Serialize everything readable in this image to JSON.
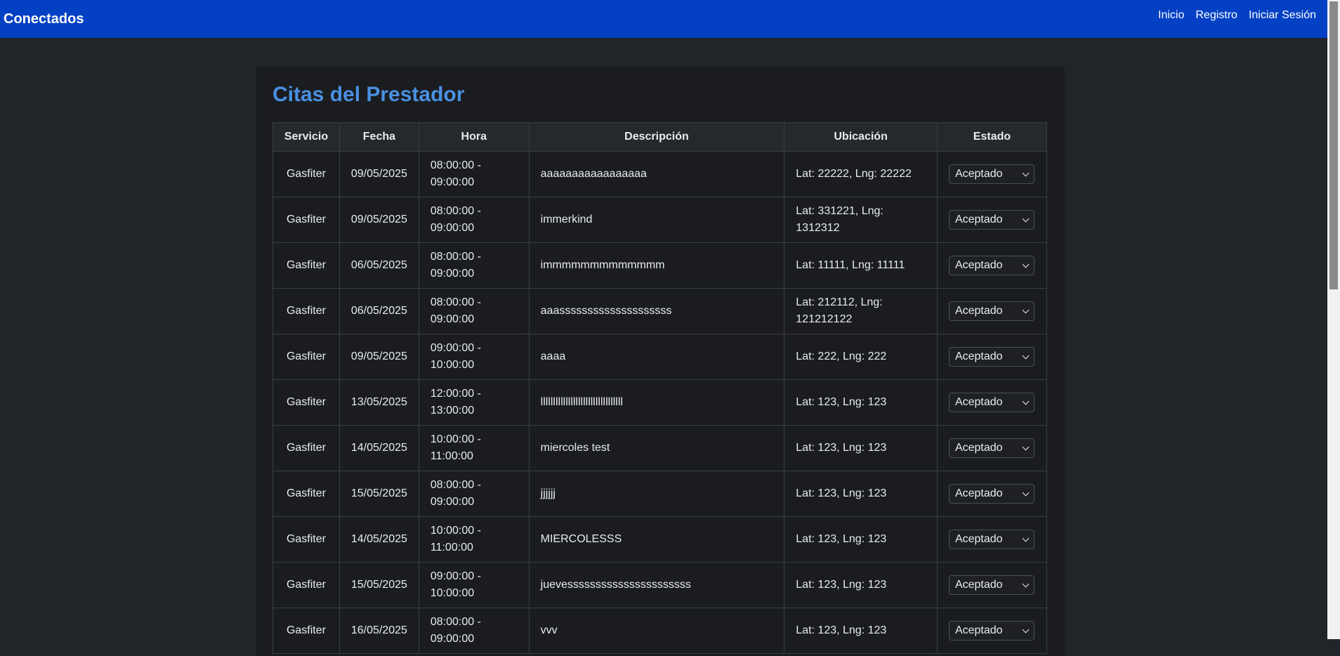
{
  "navbar": {
    "brand": "Conectados",
    "links": [
      "Inicio",
      "Registro",
      "Iniciar Sesión"
    ]
  },
  "page": {
    "title": "Citas del Prestador"
  },
  "table": {
    "headers": [
      "Servicio",
      "Fecha",
      "Hora",
      "Descripción",
      "Ubicación",
      "Estado"
    ],
    "rows": [
      {
        "servicio": "Gasfiter",
        "fecha": "09/05/2025",
        "hora": "08:00:00 - 09:00:00",
        "descripcion": "aaaaaaaaaaaaaaaaa",
        "ubicacion": "Lat: 22222, Lng: 22222",
        "estado": "Aceptado"
      },
      {
        "servicio": "Gasfiter",
        "fecha": "09/05/2025",
        "hora": "08:00:00 - 09:00:00",
        "descripcion": "immerkind",
        "ubicacion": "Lat: 331221, Lng: 1312312",
        "estado": "Aceptado"
      },
      {
        "servicio": "Gasfiter",
        "fecha": "06/05/2025",
        "hora": "08:00:00 - 09:00:00",
        "descripcion": "immmmmmmmmmmmm",
        "ubicacion": "Lat: 11111, Lng: 11111",
        "estado": "Aceptado"
      },
      {
        "servicio": "Gasfiter",
        "fecha": "06/05/2025",
        "hora": "08:00:00 - 09:00:00",
        "descripcion": "aaassssssssssssssssssss",
        "ubicacion": "Lat: 212112, Lng: 121212122",
        "estado": "Aceptado"
      },
      {
        "servicio": "Gasfiter",
        "fecha": "09/05/2025",
        "hora": "09:00:00 - 10:00:00",
        "descripcion": "aaaa",
        "ubicacion": "Lat: 222, Lng: 222",
        "estado": "Aceptado"
      },
      {
        "servicio": "Gasfiter",
        "fecha": "13/05/2025",
        "hora": "12:00:00 - 13:00:00",
        "descripcion": "lllllllllllllllllllllllllllllllll",
        "ubicacion": "Lat: 123, Lng: 123",
        "estado": "Aceptado"
      },
      {
        "servicio": "Gasfiter",
        "fecha": "14/05/2025",
        "hora": "10:00:00 - 11:00:00",
        "descripcion": "miercoles test",
        "ubicacion": "Lat: 123, Lng: 123",
        "estado": "Aceptado"
      },
      {
        "servicio": "Gasfiter",
        "fecha": "15/05/2025",
        "hora": "08:00:00 - 09:00:00",
        "descripcion": "jjjjjj",
        "ubicacion": "Lat: 123, Lng: 123",
        "estado": "Aceptado"
      },
      {
        "servicio": "Gasfiter",
        "fecha": "14/05/2025",
        "hora": "10:00:00 - 11:00:00",
        "descripcion": "MIERCOLESSS",
        "ubicacion": "Lat: 123, Lng: 123",
        "estado": "Aceptado"
      },
      {
        "servicio": "Gasfiter",
        "fecha": "15/05/2025",
        "hora": "09:00:00 - 10:00:00",
        "descripcion": "juevessssssssssssssssssssss",
        "ubicacion": "Lat: 123, Lng: 123",
        "estado": "Aceptado"
      },
      {
        "servicio": "Gasfiter",
        "fecha": "16/05/2025",
        "hora": "08:00:00 - 09:00:00",
        "descripcion": "vvv",
        "ubicacion": "Lat: 123, Lng: 123",
        "estado": "Aceptado"
      }
    ]
  },
  "icons": {
    "select_arrow": "chevron-down-icon"
  },
  "colors": {
    "navbar": "#0440c4",
    "title": "#4a90e2",
    "background": "#212429",
    "card": "#1a1c1f"
  }
}
